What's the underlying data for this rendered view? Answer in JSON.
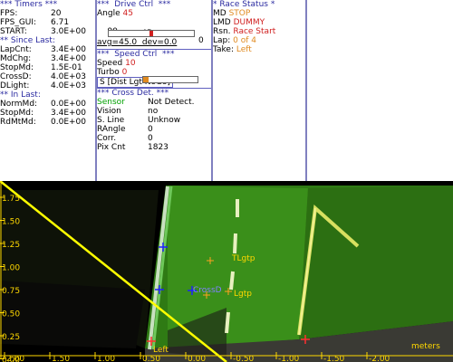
{
  "timers": {
    "header": "*** Timers ***",
    "rows": [
      {
        "k": "FPS:",
        "v": "20"
      },
      {
        "k": "FPS_GUI:",
        "v": "6.71"
      },
      {
        "k": "START:",
        "v": "3.0E+00"
      }
    ],
    "since_header": "** Since Last:",
    "since_rows": [
      {
        "k": "LapCnt:",
        "v": "3.4E+00"
      },
      {
        "k": "MdChg:",
        "v": "3.4E+00"
      },
      {
        "k": "StopMd:",
        "v": "1.5E-01"
      },
      {
        "k": "CrossD:",
        "v": "4.0E+03"
      },
      {
        "k": "DLight:",
        "v": "4.0E+03"
      }
    ],
    "in_header": "** In Last:",
    "in_rows": [
      {
        "k": "NormMd:",
        "v": "0.0E+00"
      },
      {
        "k": "StopMd:",
        "v": "3.4E+00"
      },
      {
        "k": "RdMtMd:",
        "v": "0.0E+00"
      }
    ]
  },
  "drive": {
    "header": "***  Drive Ctrl  ***",
    "angle_label": "Angle",
    "angle_value": "45",
    "slider_min": "90",
    "slider_max": "0",
    "slider_value": "45",
    "slider_fraction": 0.5,
    "stats": "avg=45.0  dev=0.0",
    "speed_header": "***  Speed Ctrl  ***",
    "speed_label": "Speed",
    "speed_value": "10",
    "speed_fraction": 0.1,
    "turbo_label": "Turbo",
    "turbo_value": "0",
    "mode_button": "S [Dist Lgt NoGo]",
    "cross_header": "*** Cross Det. ***",
    "cross_rows": [
      {
        "k": "Sensor",
        "v": "Not Detect."
      },
      {
        "k": "Vision",
        "v": "no"
      },
      {
        "k": "S. Line",
        "v": "Unknow"
      },
      {
        "k": "RAngle",
        "v": "0"
      },
      {
        "k": "Corr.",
        "v": "0"
      },
      {
        "k": "Pix Cnt",
        "v": "1823"
      }
    ]
  },
  "race": {
    "header": "* Race Status *",
    "rows": [
      {
        "k": "MD",
        "v": "STOP"
      },
      {
        "k": "LMD",
        "v": "DUMMY"
      },
      {
        "k": "Rsn.",
        "v": "Race Start"
      },
      {
        "k": "Lap:",
        "v": "0 of 4"
      },
      {
        "k": "Take:",
        "v": "Left"
      }
    ]
  },
  "view": {
    "y_ticks": [
      "1.75",
      "1.50",
      "1.25",
      "1.00",
      "0.75",
      "0.50",
      "0.25",
      "0.00"
    ],
    "x_ticks": [
      "2.00",
      "1.50",
      "1.00",
      "0.50",
      "0.00",
      "-0.50",
      "-1.00",
      "-1.50",
      "-2.00"
    ],
    "units": "meters",
    "markers": [
      {
        "label": "TLgtp"
      },
      {
        "label": "Lgtp"
      },
      {
        "label": "CrossD"
      },
      {
        "label": "Left"
      }
    ],
    "colors": {
      "axis": "#ffd800",
      "plate": "#3a8a1a",
      "shadow": "#0a1a06"
    }
  }
}
